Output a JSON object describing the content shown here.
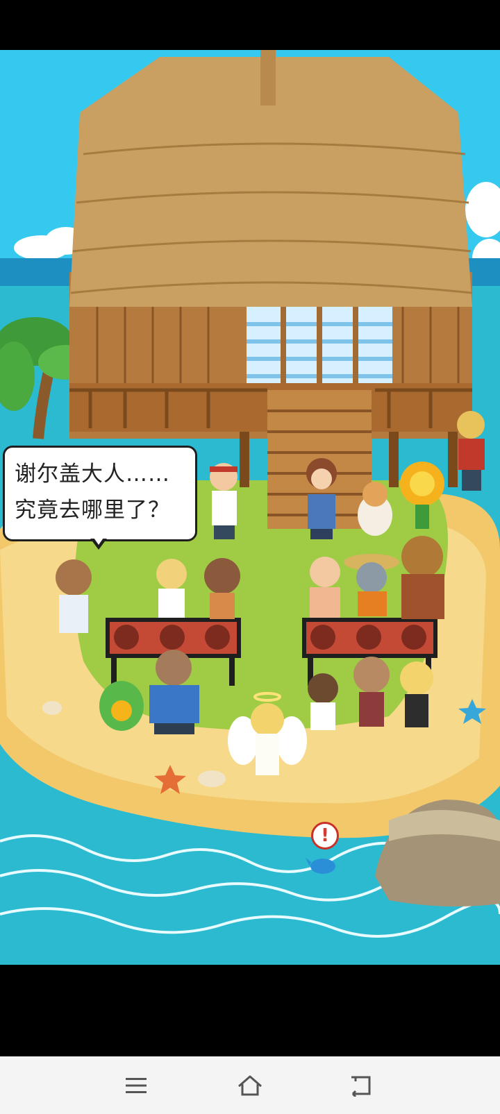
{
  "dialog": {
    "line1": "谢尔盖大人……",
    "line2": "究竟去哪里了？"
  },
  "alert": {
    "symbol": "!"
  },
  "navigation": {
    "menu_icon": "menu-icon",
    "home_icon": "home-icon",
    "back_icon": "back-icon"
  },
  "colors": {
    "sky": "#35c9ef",
    "sea": "#2bbad0",
    "sand": "#f2c86b",
    "grass": "#9fcb45",
    "thatch": "#c9a062",
    "wood": "#a46a33",
    "navbar": "#f4f4f4"
  }
}
